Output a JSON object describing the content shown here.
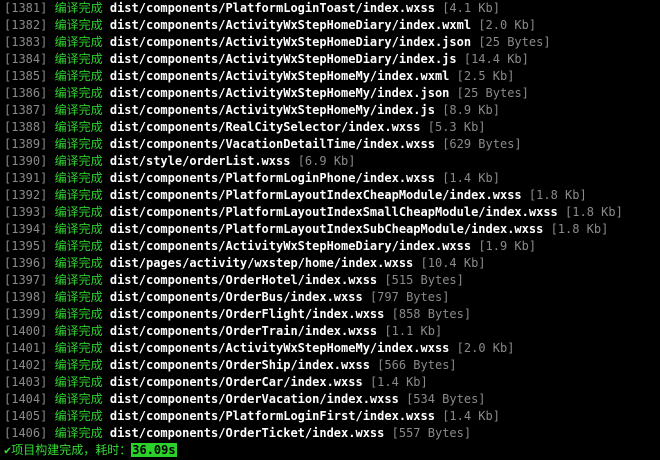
{
  "log": {
    "status_label": "编译完成",
    "entries": [
      {
        "index": "[1381]",
        "path": "dist/components/PlatformLoginToast/index.wxss",
        "size": "[4.1 Kb]"
      },
      {
        "index": "[1382]",
        "path": "dist/components/ActivityWxStepHomeDiary/index.wxml",
        "size": "[2.0 Kb]"
      },
      {
        "index": "[1383]",
        "path": "dist/components/ActivityWxStepHomeDiary/index.json",
        "size": "[25 Bytes]"
      },
      {
        "index": "[1384]",
        "path": "dist/components/ActivityWxStepHomeDiary/index.js",
        "size": "[14.4 Kb]"
      },
      {
        "index": "[1385]",
        "path": "dist/components/ActivityWxStepHomeMy/index.wxml",
        "size": "[2.5 Kb]"
      },
      {
        "index": "[1386]",
        "path": "dist/components/ActivityWxStepHomeMy/index.json",
        "size": "[25 Bytes]"
      },
      {
        "index": "[1387]",
        "path": "dist/components/ActivityWxStepHomeMy/index.js",
        "size": "[8.9 Kb]"
      },
      {
        "index": "[1388]",
        "path": "dist/components/RealCitySelector/index.wxss",
        "size": "[5.3 Kb]"
      },
      {
        "index": "[1389]",
        "path": "dist/components/VacationDetailTime/index.wxss",
        "size": "[629 Bytes]"
      },
      {
        "index": "[1390]",
        "path": "dist/style/orderList.wxss",
        "size": "[6.9 Kb]"
      },
      {
        "index": "[1391]",
        "path": "dist/components/PlatformLoginPhone/index.wxss",
        "size": "[1.4 Kb]"
      },
      {
        "index": "[1392]",
        "path": "dist/components/PlatformLayoutIndexCheapModule/index.wxss",
        "size": "[1.8 Kb]"
      },
      {
        "index": "[1393]",
        "path": "dist/components/PlatformLayoutIndexSmallCheapModule/index.wxss",
        "size": "[1.8 Kb]"
      },
      {
        "index": "[1394]",
        "path": "dist/components/PlatformLayoutIndexSubCheapModule/index.wxss",
        "size": "[1.8 Kb]"
      },
      {
        "index": "[1395]",
        "path": "dist/components/ActivityWxStepHomeDiary/index.wxss",
        "size": "[1.9 Kb]"
      },
      {
        "index": "[1396]",
        "path": "dist/pages/activity/wxstep/home/index.wxss",
        "size": "[10.4 Kb]"
      },
      {
        "index": "[1397]",
        "path": "dist/components/OrderHotel/index.wxss",
        "size": "[515 Bytes]"
      },
      {
        "index": "[1398]",
        "path": "dist/components/OrderBus/index.wxss",
        "size": "[797 Bytes]"
      },
      {
        "index": "[1399]",
        "path": "dist/components/OrderFlight/index.wxss",
        "size": "[858 Bytes]"
      },
      {
        "index": "[1400]",
        "path": "dist/components/OrderTrain/index.wxss",
        "size": "[1.1 Kb]"
      },
      {
        "index": "[1401]",
        "path": "dist/components/ActivityWxStepHomeMy/index.wxss",
        "size": "[2.0 Kb]"
      },
      {
        "index": "[1402]",
        "path": "dist/components/OrderShip/index.wxss",
        "size": "[566 Bytes]"
      },
      {
        "index": "[1403]",
        "path": "dist/components/OrderCar/index.wxss",
        "size": "[1.4 Kb]"
      },
      {
        "index": "[1404]",
        "path": "dist/components/OrderVacation/index.wxss",
        "size": "[534 Bytes]"
      },
      {
        "index": "[1405]",
        "path": "dist/components/PlatformLoginFirst/index.wxss",
        "size": "[1.4 Kb]"
      },
      {
        "index": "[1406]",
        "path": "dist/components/OrderTicket/index.wxss",
        "size": "[557 Bytes]"
      }
    ]
  },
  "summary": {
    "check_glyph": "✔",
    "label": "项目构建完成，耗时：",
    "time": "36.09s"
  },
  "colors": {
    "background": "#000000",
    "index": "#8a8a8a",
    "status": "#2fd02f",
    "path": "#ffffff",
    "size": "#8a8a8a",
    "time_badge": "#2bd02b"
  }
}
